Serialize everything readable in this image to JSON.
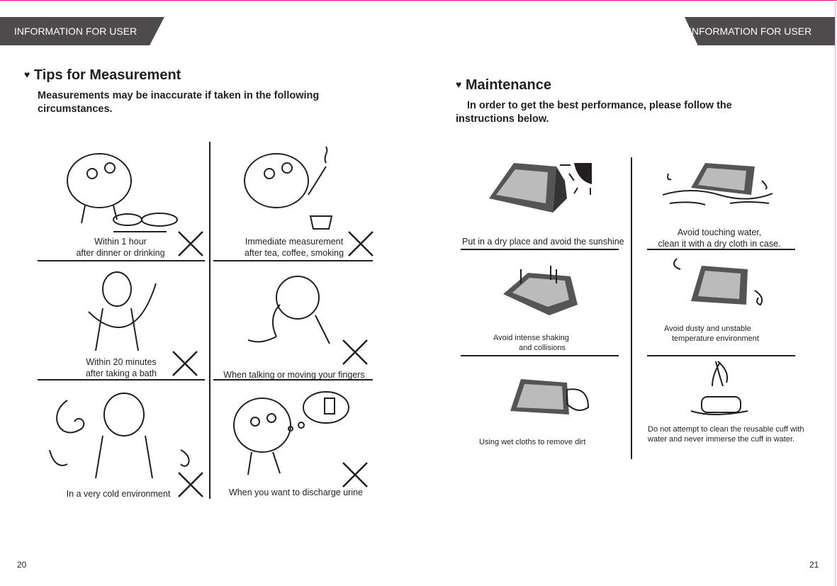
{
  "header": {
    "left_banner": "INFORMATION FOR USER",
    "right_banner": "INFORMATION FOR USER"
  },
  "tips": {
    "title": "Tips for Measurement",
    "intro": "Measurements may be inaccurate if taken in the following circumstances.",
    "items": [
      {
        "line1": "Within 1 hour",
        "line2": "after dinner or drinking"
      },
      {
        "line1": "Immediate measurement",
        "line2": "after tea, coffee, smoking"
      },
      {
        "line1": "Within 20 minutes",
        "line2": "after taking a bath"
      },
      {
        "line1": "When talking or moving your fingers"
      },
      {
        "line1": "In a very cold environment"
      },
      {
        "line1": "When you want to discharge urine"
      }
    ]
  },
  "maintenance": {
    "title": "Maintenance",
    "intro": "In order to get the best performance, please follow the instructions below.",
    "items": [
      {
        "line1": "Put in a dry place and avoid the sunshine"
      },
      {
        "line1": "Avoid touching water,",
        "line2": "clean it with a dry cloth in case."
      },
      {
        "line1": "Avoid intense shaking",
        "line2": "and collisions"
      },
      {
        "line1": "Avoid dusty and unstable",
        "line2": "temperature environment"
      },
      {
        "line1": "Using wet cloths to remove dirt"
      },
      {
        "line1": "Do not attempt to clean the reusable cuff with water and never immerse the cuff in water."
      }
    ]
  },
  "footer": {
    "left_page": "20",
    "right_page": "21"
  },
  "colors": {
    "banner": "#4d4b4c",
    "accent_line": "#e4007f",
    "text": "#231f20"
  }
}
